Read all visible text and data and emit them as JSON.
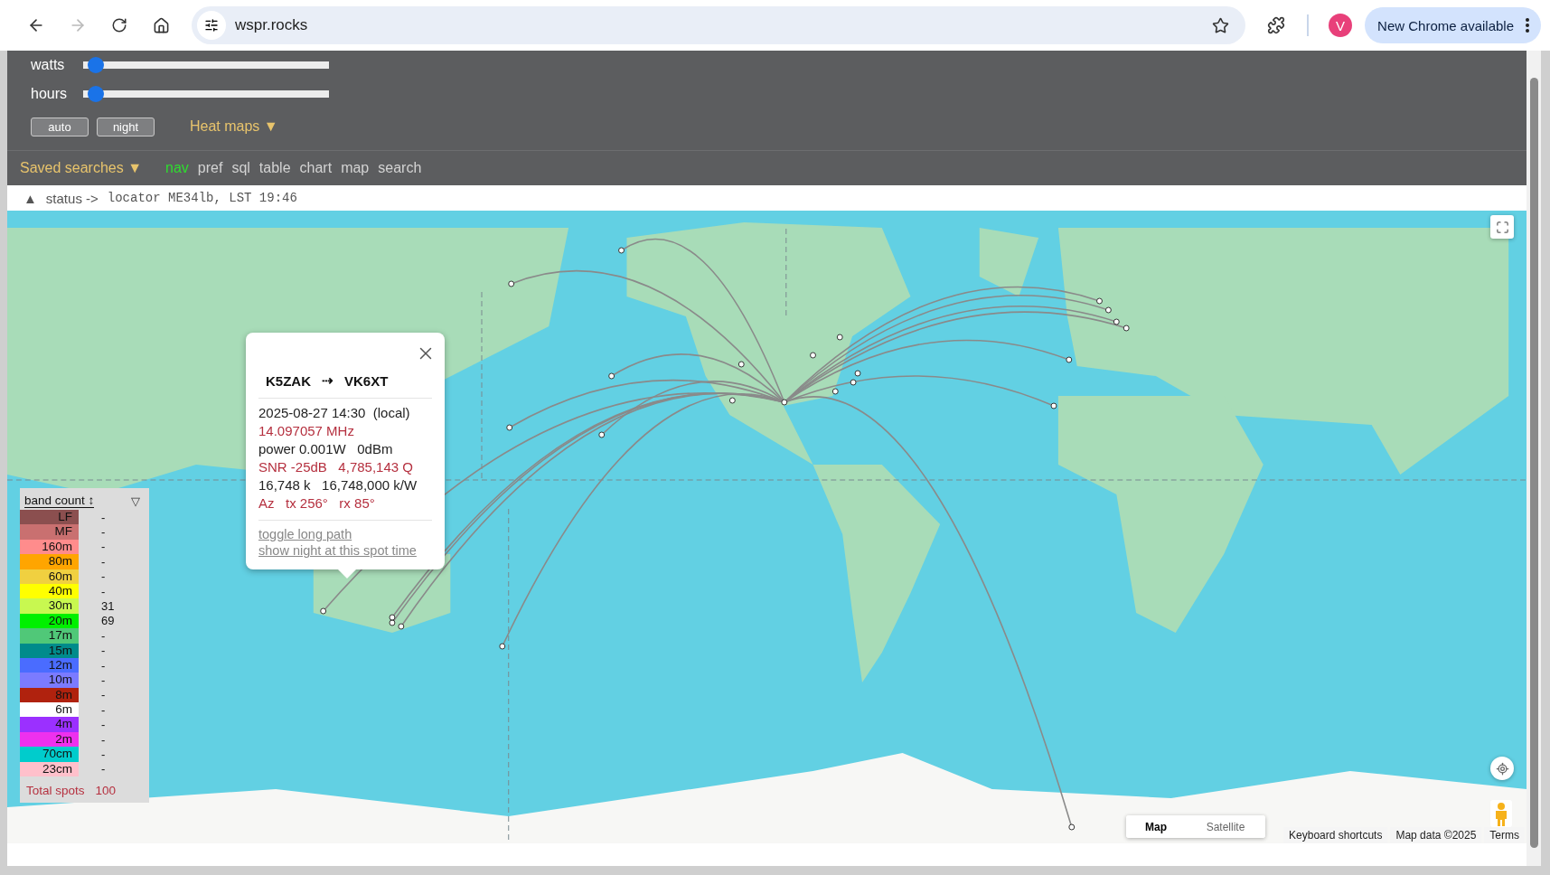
{
  "browser": {
    "forward_disabled": true,
    "url": "wspr.rocks",
    "avatar": "V",
    "update_button": "New Chrome available"
  },
  "controls": {
    "sliders": [
      {
        "label": "watts",
        "level": 0.02
      },
      {
        "label": "hours",
        "level": 0.02
      }
    ],
    "buttons": [
      "auto",
      "night"
    ],
    "heat_maps": "Heat maps ▼"
  },
  "nav": {
    "saved_searches": "Saved searches ▼",
    "tabs": [
      {
        "label": "nav",
        "selected": true
      },
      {
        "label": "pref",
        "selected": false
      },
      {
        "label": "sql",
        "selected": false
      },
      {
        "label": "table",
        "selected": false
      },
      {
        "label": "chart",
        "selected": false
      },
      {
        "label": "map",
        "selected": false
      },
      {
        "label": "search",
        "selected": false
      }
    ]
  },
  "status": {
    "toggle": "▲",
    "label": "status ->",
    "text": "locator ME34lb, LST 19:46"
  },
  "popup": {
    "from": "K5ZAK",
    "arrow": "⇢",
    "to": "VK6XT",
    "lines": [
      {
        "text": "2025-08-27 14:30  (local)",
        "kind": "plain"
      },
      {
        "text": "14.097057 MHz",
        "kind": "accent"
      },
      {
        "text": "power 0.001W   0dBm",
        "kind": "plain"
      },
      {
        "text": "SNR -25dB   4,785,143 Q",
        "kind": "accent"
      },
      {
        "text": "16,748 k   16,748,000 k/W",
        "kind": "plain"
      },
      {
        "text": "Az   tx 256°   rx 85°",
        "kind": "accent"
      }
    ],
    "links": [
      "toggle long path",
      "show night at this spot time"
    ]
  },
  "legend": {
    "header": "band count ↕",
    "filter": "▽",
    "bands": [
      {
        "label": "LF",
        "color": "#8b4f4f",
        "count": "-"
      },
      {
        "label": "MF",
        "color": "#c97070",
        "count": "-"
      },
      {
        "label": "160m",
        "color": "#ff8c8c",
        "count": "-"
      },
      {
        "label": "80m",
        "color": "#ffa500",
        "count": "-"
      },
      {
        "label": "60m",
        "color": "#f0d040",
        "count": "-"
      },
      {
        "label": "40m",
        "color": "#ffff00",
        "count": "-"
      },
      {
        "label": "30m",
        "color": "#c8f850",
        "count": "31"
      },
      {
        "label": "20m",
        "color": "#00f000",
        "count": "69"
      },
      {
        "label": "17m",
        "color": "#50c878",
        "count": "-"
      },
      {
        "label": "15m",
        "color": "#008b8b",
        "count": "-"
      },
      {
        "label": "12m",
        "color": "#4a6cff",
        "count": "-"
      },
      {
        "label": "10m",
        "color": "#7b7bff",
        "count": "-"
      },
      {
        "label": "8m",
        "color": "#b0220e",
        "count": "-"
      },
      {
        "label": "6m",
        "color": "#ffffff",
        "count": "-"
      },
      {
        "label": "4m",
        "color": "#9b30ff",
        "count": "-"
      },
      {
        "label": "2m",
        "color": "#ee30ee",
        "count": "-"
      },
      {
        "label": "70cm",
        "color": "#00cccc",
        "count": "-"
      },
      {
        "label": "23cm",
        "color": "#ffc0cb",
        "count": "-"
      }
    ],
    "total_label": "Total spots",
    "total": "100"
  },
  "map_controls": {
    "map_types": [
      {
        "label": "Map",
        "selected": true
      },
      {
        "label": "Satellite",
        "selected": false
      }
    ],
    "footer": [
      "Keyboard shortcuts",
      "Map data ©2025",
      "Terms"
    ]
  }
}
